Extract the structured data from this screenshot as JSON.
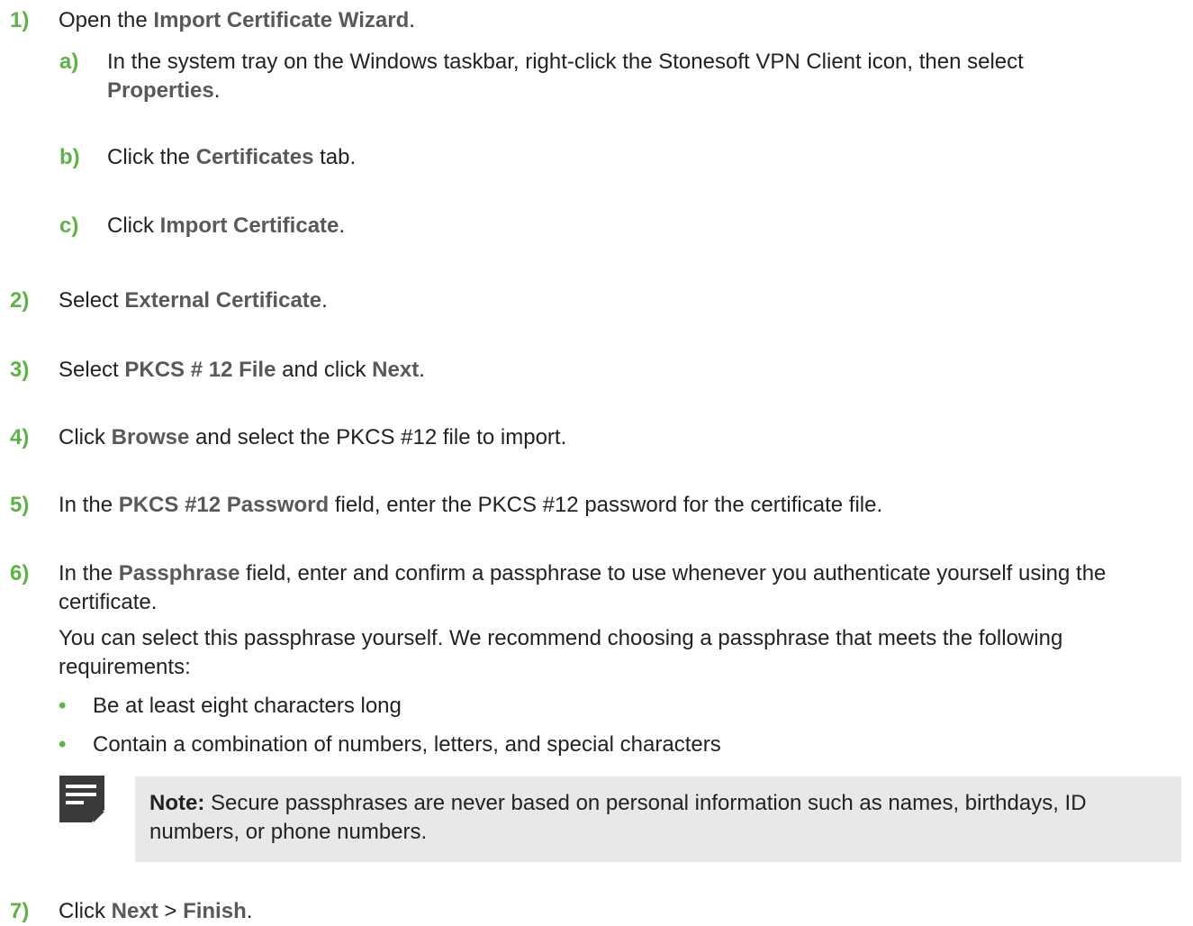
{
  "steps": [
    {
      "num": "1)",
      "pre": "Open the ",
      "ui": "Import Certificate Wizard",
      "post": "."
    },
    {
      "num": "2)",
      "pre": "Select ",
      "ui": "External Certificate",
      "post": "."
    },
    {
      "num": "3)",
      "pre": "Select ",
      "ui": "PKCS # 12 File",
      "mid": " and click ",
      "ui2": "Next",
      "post": "."
    },
    {
      "num": "4)",
      "pre": "Click ",
      "ui": "Browse",
      "post": " and select the PKCS #12 file to import."
    },
    {
      "num": "5)",
      "pre": "In the ",
      "ui": "PKCS #12 Password",
      "post": " field, enter the PKCS #12 password for the certificate file."
    },
    {
      "num": "6)",
      "pre": "In the ",
      "ui": "Passphrase",
      "post": " field, enter and confirm a passphrase to use whenever you authenticate yourself using the certificate."
    },
    {
      "num": "7)",
      "pre": "Click ",
      "ui": "Next",
      "mid": " > ",
      "ui2": "Finish",
      "post": "."
    }
  ],
  "substeps": [
    {
      "num": "a)",
      "pre": "In the system tray on the Windows taskbar, right-click the Stonesoft VPN Client icon, then select ",
      "ui": "Properties",
      "post": "."
    },
    {
      "num": "b)",
      "pre": "Click the ",
      "ui": "Certificates",
      "post": " tab."
    },
    {
      "num": "c)",
      "pre": "Click ",
      "ui": "Import Certificate",
      "post": "."
    }
  ],
  "step6_detail": "You can select this passphrase yourself. We recommend choosing a passphrase that meets the following requirements:",
  "bullets": [
    {
      "mark": "•",
      "text": "Be at least eight characters long"
    },
    {
      "mark": "•",
      "text": "Contain a combination of numbers, letters, and special characters"
    }
  ],
  "note": {
    "label": "Note:",
    "text": "  Secure passphrases are never based on personal information such as names, birthdays, ID numbers, or phone numbers.",
    "icon": "note-icon"
  },
  "colors": {
    "step_number": "#5bb544",
    "ui_term": "#595959",
    "note_background": "#e8e8e8",
    "note_icon": "#3a3a3a"
  }
}
